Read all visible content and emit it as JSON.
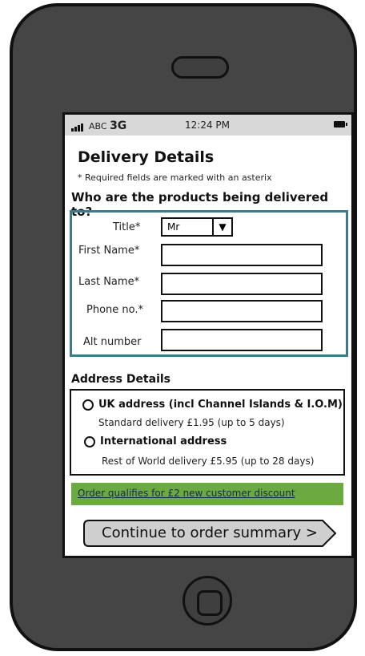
{
  "status_bar": {
    "carrier": "ABC",
    "network": "3G",
    "time": "12:24 PM",
    "battery_icon": "battery-icon",
    "signal_icon": "signal-bars-icon"
  },
  "page": {
    "title": "Delivery Details",
    "required_note": "* Required fields are marked with an asterix",
    "question": "Who are the products being delivered to?"
  },
  "form": {
    "title_label": "Title*",
    "title_value": "Mr",
    "first_name_label": "First Name*",
    "last_name_label": "Last Name*",
    "phone_label": "Phone no.*",
    "alt_number_label": "Alt number"
  },
  "address": {
    "heading": "Address Details",
    "options": [
      {
        "title": "UK address (incl Channel Islands & I.O.M)",
        "detail": "Standard delivery £1.95 (up to 5 days)"
      },
      {
        "title": "International address",
        "detail": "Rest of World delivery £5.95 (up to 28 days)"
      }
    ]
  },
  "discount": {
    "text": "Order qualifies for £2 new customer discount",
    "color": "#6aaa3e"
  },
  "cta": {
    "label": "Continue to order summary >"
  },
  "colors": {
    "form_border": "#3d7a8a",
    "phone_body": "#454545"
  }
}
